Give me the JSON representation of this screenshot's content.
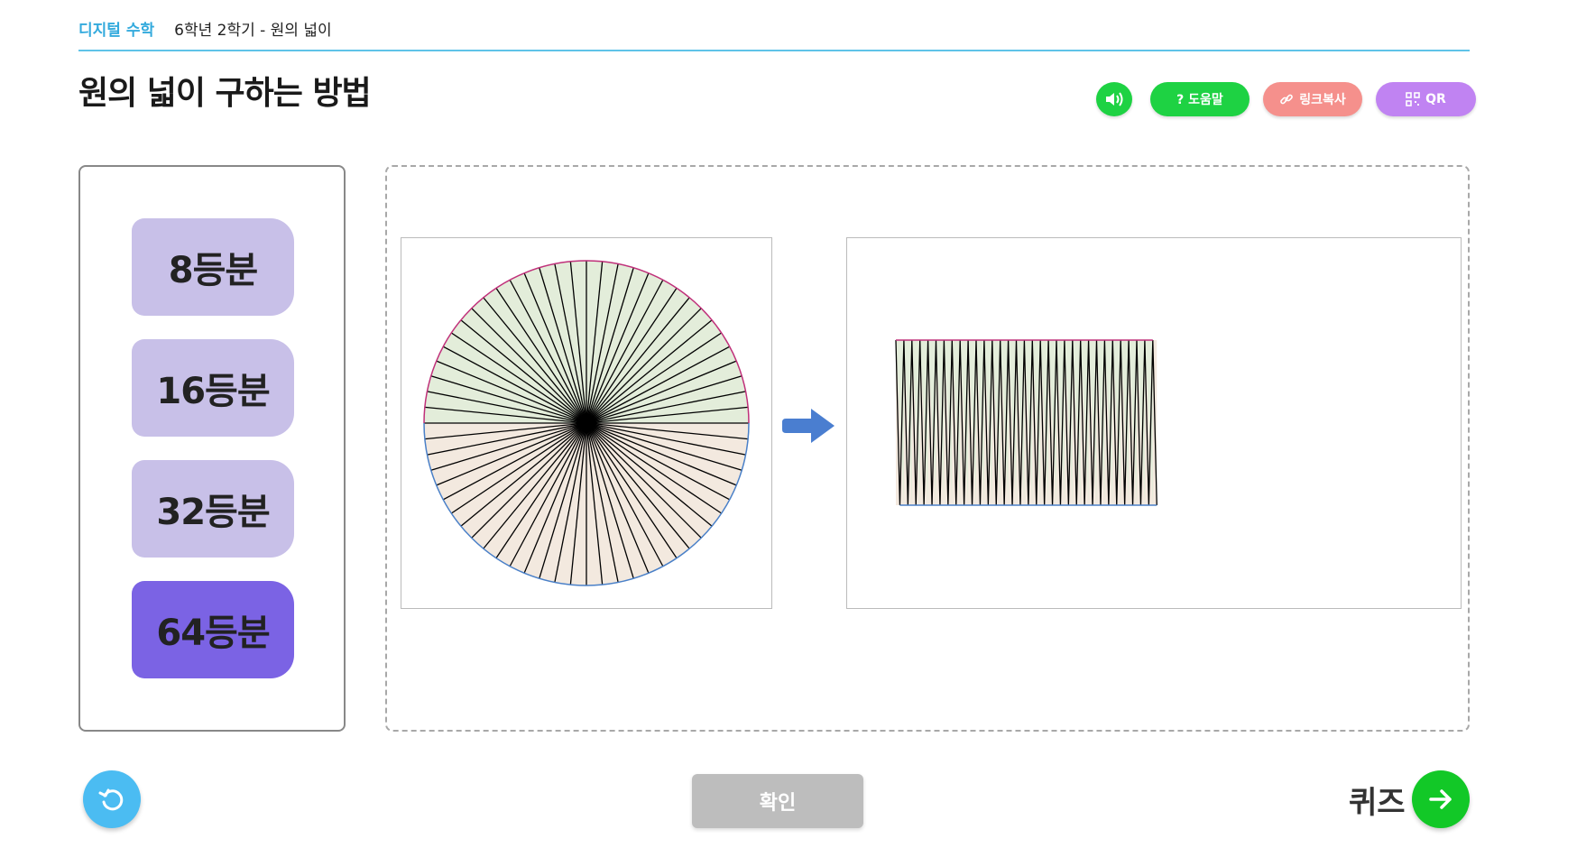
{
  "header": {
    "brand": "디지털 수학",
    "course": "6학년 2학기 - 원의 넓이",
    "title": "원의 넓이 구하는 방법"
  },
  "toolbar": {
    "sound_icon": "speaker-icon",
    "help_label": "? 도움말",
    "link_label": "링크복사",
    "qr_label": "QR"
  },
  "divisions": {
    "options": [
      "8등분",
      "16등분",
      "32등분",
      "64등분"
    ],
    "selected": "64등분",
    "sectors": 64
  },
  "colors": {
    "accent_line": "#5fc3e8",
    "brand_text": "#33aadd",
    "option_bg": "#c8c0e8",
    "option_active_bg": "#7b63e4",
    "upper_fill": "#e3edda",
    "lower_fill": "#f3e9df",
    "upper_arc": "#c0307a",
    "lower_arc": "#4a80c8",
    "arrow": "#4a7ed0",
    "sound_btn": "#1ed243",
    "help_btn": "#1ed243",
    "link_btn": "#f5908c",
    "qr_btn": "#c083f2",
    "reset_btn": "#4bbcf2",
    "next_btn": "#12c827",
    "confirm_btn": "#bdbdbd"
  },
  "footer": {
    "reset_icon": "reset-icon",
    "confirm_label": "확인",
    "quiz_label": "퀴즈",
    "next_icon": "arrow-right-icon"
  }
}
